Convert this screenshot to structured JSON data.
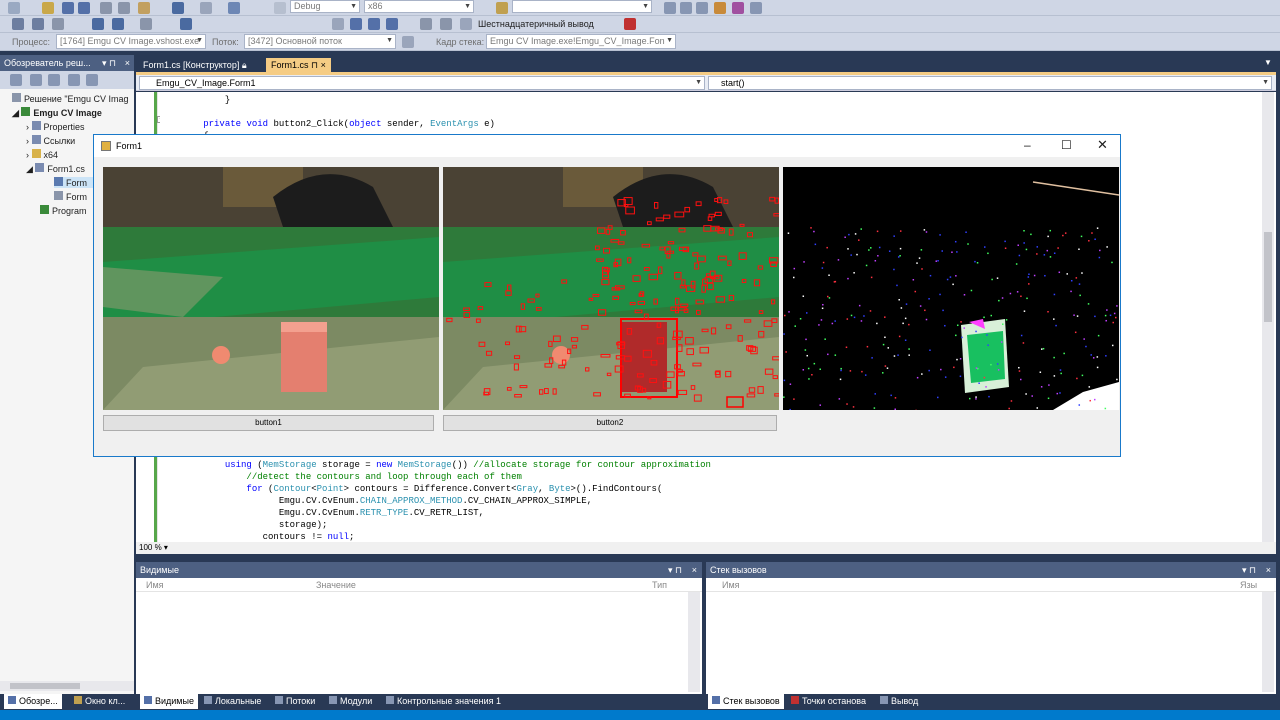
{
  "toolbar1": {
    "config": "Debug",
    "platform": "x86",
    "hex_output": "Шестнадцатеричный вывод"
  },
  "toolbar2": {
    "process_label": "Процесс:",
    "process_value": "[1764] Emgu CV Image.vshost.exe",
    "thread_label": "Поток:",
    "thread_value": "[3472] Основной поток",
    "frame_label": "Кадр стека:",
    "frame_value": "Emgu CV Image.exe!Emgu_CV_Image.Fon"
  },
  "solution_explorer": {
    "title": "Обозреватель реш...",
    "items": [
      "Решение \"Emgu CV Imag",
      "Emgu CV Image",
      "Properties",
      "Ссылки",
      "x64",
      "Form1.cs",
      "Form",
      "Form",
      "Program"
    ]
  },
  "doc_tabs": [
    "Form1.cs [Конструктор]",
    "Form1.cs"
  ],
  "nav": {
    "class_combo": "Emgu_CV_Image.Form1",
    "member_combo": "start()"
  },
  "code_lines": [
    {
      "indent": "            ",
      "parts": [
        {
          "t": "}",
          "c": ""
        }
      ]
    },
    {
      "indent": "",
      "parts": []
    },
    {
      "indent": "        ",
      "parts": [
        {
          "t": "private ",
          "c": "kw"
        },
        {
          "t": "void ",
          "c": "kw"
        },
        {
          "t": "button2_Click(",
          "c": ""
        },
        {
          "t": "object ",
          "c": "kw"
        },
        {
          "t": "sender, ",
          "c": ""
        },
        {
          "t": "EventArgs ",
          "c": "ty"
        },
        {
          "t": "e)",
          "c": ""
        }
      ]
    },
    {
      "indent": "        ",
      "parts": [
        {
          "t": "{",
          "c": ""
        }
      ]
    }
  ],
  "code_lines_bottom": [
    {
      "indent": "            ",
      "parts": [
        {
          "t": "using ",
          "c": "kw"
        },
        {
          "t": "(",
          "c": ""
        },
        {
          "t": "MemStorage ",
          "c": "ty"
        },
        {
          "t": "storage = ",
          "c": ""
        },
        {
          "t": "new ",
          "c": "kw"
        },
        {
          "t": "MemStorage",
          "c": "ty"
        },
        {
          "t": "()) ",
          "c": ""
        },
        {
          "t": "//allocate storage for contour approximation",
          "c": "cm"
        }
      ]
    },
    {
      "indent": "                ",
      "parts": [
        {
          "t": "//detect the contours and loop through each of them",
          "c": "cm"
        }
      ]
    },
    {
      "indent": "                ",
      "parts": [
        {
          "t": "for ",
          "c": "kw"
        },
        {
          "t": "(",
          "c": ""
        },
        {
          "t": "Contour",
          "c": "ty"
        },
        {
          "t": "<",
          "c": ""
        },
        {
          "t": "Point",
          "c": "ty"
        },
        {
          "t": "> contours = Difference.Convert<",
          "c": ""
        },
        {
          "t": "Gray",
          "c": "ty"
        },
        {
          "t": ", ",
          "c": ""
        },
        {
          "t": "Byte",
          "c": "ty"
        },
        {
          "t": ">().FindContours(",
          "c": ""
        }
      ]
    },
    {
      "indent": "                      ",
      "parts": [
        {
          "t": "Emgu.CV.CvEnum.",
          "c": ""
        },
        {
          "t": "CHAIN_APPROX_METHOD",
          "c": "ty"
        },
        {
          "t": ".CV_CHAIN_APPROX_SIMPLE,",
          "c": ""
        }
      ]
    },
    {
      "indent": "                      ",
      "parts": [
        {
          "t": "Emgu.CV.CvEnum.",
          "c": ""
        },
        {
          "t": "RETR_TYPE",
          "c": "ty"
        },
        {
          "t": ".CV_RETR_LIST,",
          "c": ""
        }
      ]
    },
    {
      "indent": "                      ",
      "parts": [
        {
          "t": "storage);",
          "c": ""
        }
      ]
    },
    {
      "indent": "                   ",
      "parts": [
        {
          "t": "contours != ",
          "c": ""
        },
        {
          "t": "null",
          "c": "kw"
        },
        {
          "t": ";",
          "c": ""
        }
      ]
    }
  ],
  "zoom": "100 %",
  "form": {
    "title": "Form1",
    "button1": "button1",
    "button2": "button2"
  },
  "locals": {
    "title": "Видимые",
    "col_name": "Имя",
    "col_value": "Значение",
    "col_type": "Тип"
  },
  "callstack": {
    "title": "Стек вызовов",
    "col_name": "Имя",
    "col_lang": "Язы"
  },
  "bottom_tabs_left": [
    "Обозре...",
    "Окно кл..."
  ],
  "bottom_tabs_mid": [
    "Видимые",
    "Локальные",
    "Потоки",
    "Модули",
    "Контрольные значения 1"
  ],
  "bottom_tabs_right": [
    "Стек вызовов",
    "Точки останова",
    "Вывод"
  ]
}
